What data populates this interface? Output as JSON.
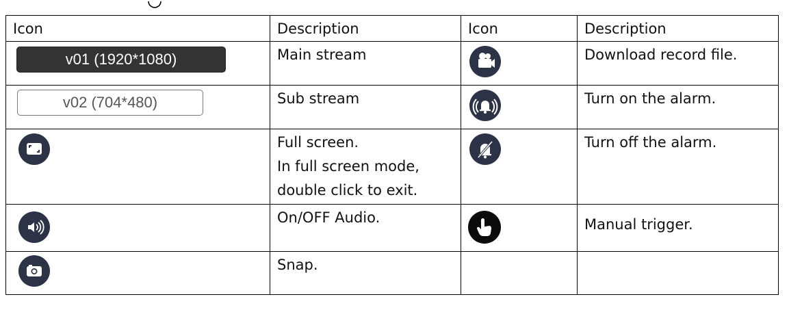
{
  "header": {
    "icon": "Icon",
    "description": "Description",
    "icon2": "Icon",
    "description2": "Description"
  },
  "rows": [
    {
      "left_label": "v01 (1920*1080)",
      "left_desc": "Main stream",
      "right_icon": "video-camera-icon",
      "right_desc": "Download record file."
    },
    {
      "left_label": "v02 (704*480)",
      "left_desc": "Sub stream",
      "right_icon": "alarm-bell-icon",
      "right_desc": "Turn on the alarm."
    },
    {
      "left_icon": "fullscreen-icon",
      "left_desc_lines": [
        "Full screen.",
        "In full screen mode,",
        "double click to exit."
      ],
      "right_icon": "alarm-off-icon",
      "right_desc": "Turn off the alarm."
    },
    {
      "left_icon": "speaker-icon",
      "left_desc": "On/OFF Audio.",
      "right_icon": "pointing-hand-icon",
      "right_desc": "Manual trigger."
    },
    {
      "left_icon": "camera-icon",
      "left_desc": "Snap."
    }
  ],
  "colors": {
    "icon_bg": "#2c3346",
    "main_stream_bg": "#333333",
    "trigger_bg": "#0b0b0b"
  }
}
